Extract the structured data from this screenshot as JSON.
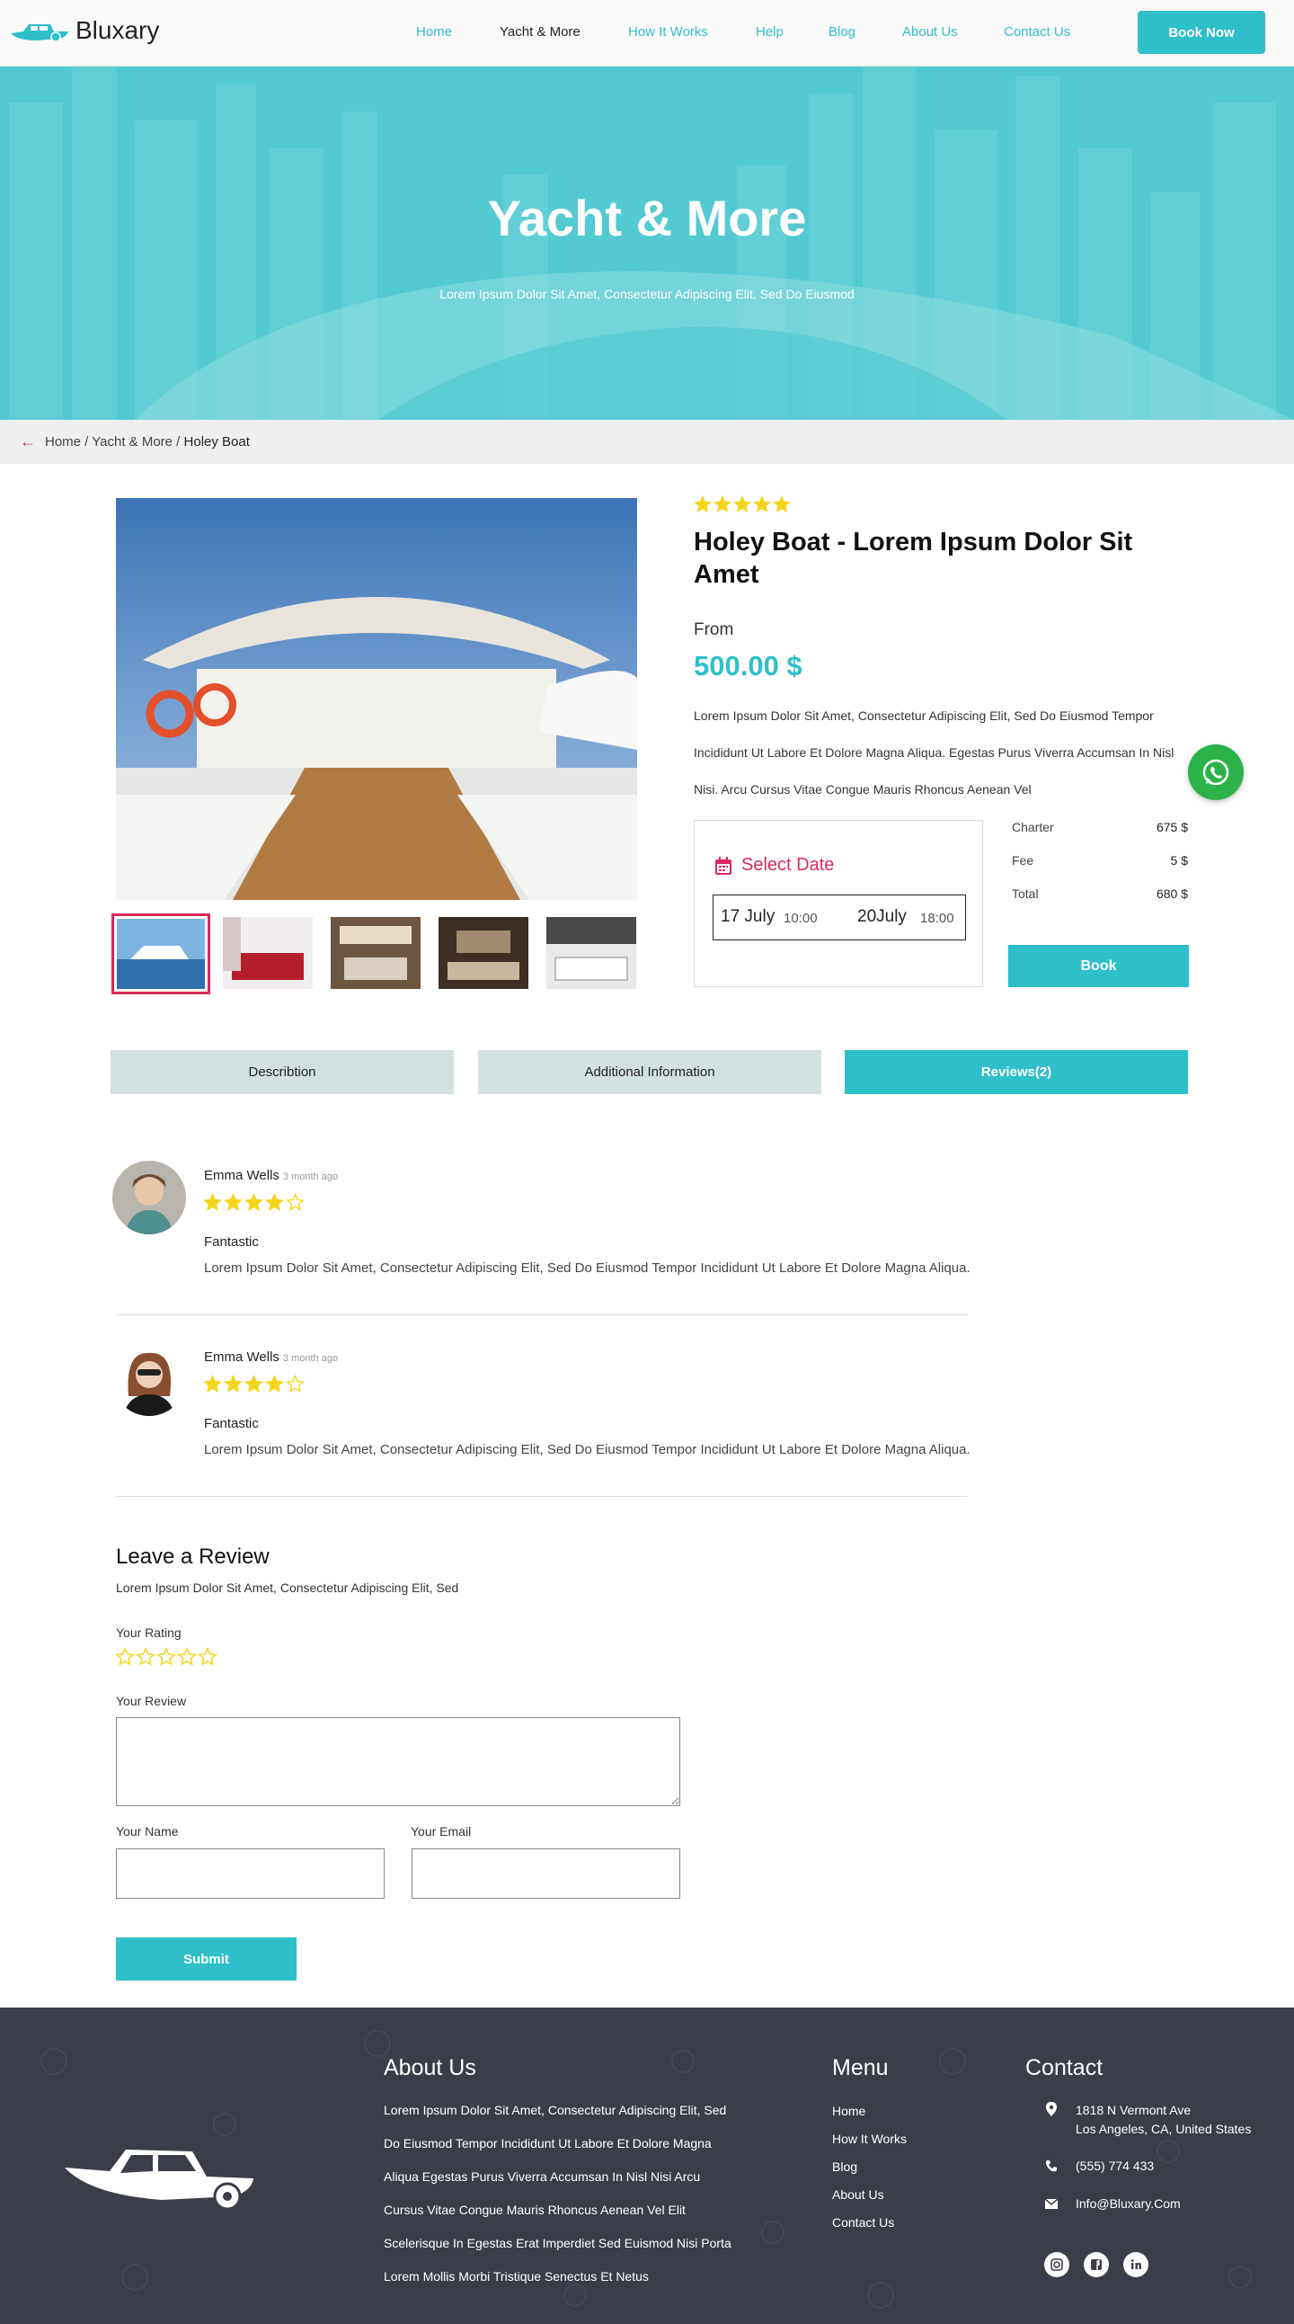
{
  "header": {
    "logo": "Bluxary",
    "nav": [
      "Home",
      "Yacht & More",
      "How It Works",
      "Help",
      "Blog",
      "About Us",
      "Contact Us"
    ],
    "active_nav": "Yacht & More",
    "book_now": "Book Now"
  },
  "hero": {
    "title": "Yacht & More",
    "subtitle": "Lorem Ipsum Dolor Sit Amet, Consectetur Adipiscing Elit, Sed Do Eiusmod"
  },
  "breadcrumb": {
    "trail": "Home / Yacht & More  / ",
    "current": "Holey Boat"
  },
  "product": {
    "rating": 5,
    "title": "Holey Boat - Lorem Ipsum Dolor Sit Amet",
    "from_label": "From",
    "price": "500.00 $",
    "description": "Lorem Ipsum Dolor Sit Amet, Consectetur Adipiscing Elit, Sed Do Eiusmod Tempor Incididunt Ut Labore Et Dolore Magna Aliqua. Egestas Purus Viverra Accumsan In Nisl Nisi. Arcu Cursus Vitae Congue Mauris Rhoncus Aenean Vel",
    "select_date_label": "Select Date",
    "start_date": "17 July",
    "start_time": "10:00",
    "end_date": "20July",
    "end_time": "18:00",
    "charges": [
      {
        "label": "Charter",
        "value": "675 $"
      },
      {
        "label": "Fee",
        "value": "5 $"
      },
      {
        "label": "Total",
        "value": "680 $"
      }
    ],
    "book_label": "Book"
  },
  "tabs": [
    {
      "label": "Describtion",
      "active": false
    },
    {
      "label": "Additional Information",
      "active": false
    },
    {
      "label": "Reviews(2)",
      "active": true
    }
  ],
  "reviews": [
    {
      "name": "Emma Wells",
      "ago": "3 month ago",
      "rating": 4,
      "title": "Fantastic",
      "text": "Lorem Ipsum Dolor Sit Amet, Consectetur Adipiscing Elit, Sed Do Eiusmod Tempor Incididunt Ut Labore Et Dolore Magna Aliqua."
    },
    {
      "name": "Emma Wells",
      "ago": "3 month ago",
      "rating": 4,
      "title": "Fantastic",
      "text": "Lorem Ipsum Dolor Sit Amet, Consectetur Adipiscing Elit, Sed Do Eiusmod Tempor Incididunt Ut Labore Et Dolore Magna Aliqua."
    }
  ],
  "review_form": {
    "title": "Leave a Review",
    "subtitle": "Lorem Ipsum Dolor Sit Amet, Consectetur Adipiscing Elit, Sed",
    "rating_label": "Your Rating",
    "review_label": "Your Review",
    "name_label": "Your Name",
    "email_label": "Your Email",
    "submit_label": "Submit"
  },
  "footer": {
    "about_title": "About Us",
    "about_lines": [
      "Lorem Ipsum Dolor Sit Amet, Consectetur Adipiscing Elit, Sed",
      "Do Eiusmod Tempor Incididunt Ut Labore Et Dolore Magna",
      "Aliqua Egestas Purus Viverra Accumsan In Nisl Nisi Arcu",
      "Cursus Vitae Congue Mauris Rhoncus Aenean Vel Elit",
      "Scelerisque In Egestas Erat Imperdiet Sed Euismod Nisi Porta",
      "Lorem Mollis Morbi Tristique Senectus Et Netus"
    ],
    "menu_title": "Menu",
    "menu_items": [
      "Home",
      "How It Works",
      "Blog",
      "About Us",
      "Contact Us"
    ],
    "contact_title": "Contact",
    "address_line1": "1818 N Vermont Ave",
    "address_line2": "Los Angeles, CA, United States",
    "phone": "(555) 774 433",
    "email": "Info@Bluxary.Com"
  },
  "colors": {
    "accent": "#2fbfc9",
    "highlight": "#d62b5b",
    "star": "#f5d41c",
    "footer_bg": "#3b3e49",
    "whatsapp": "#2bb34a"
  }
}
